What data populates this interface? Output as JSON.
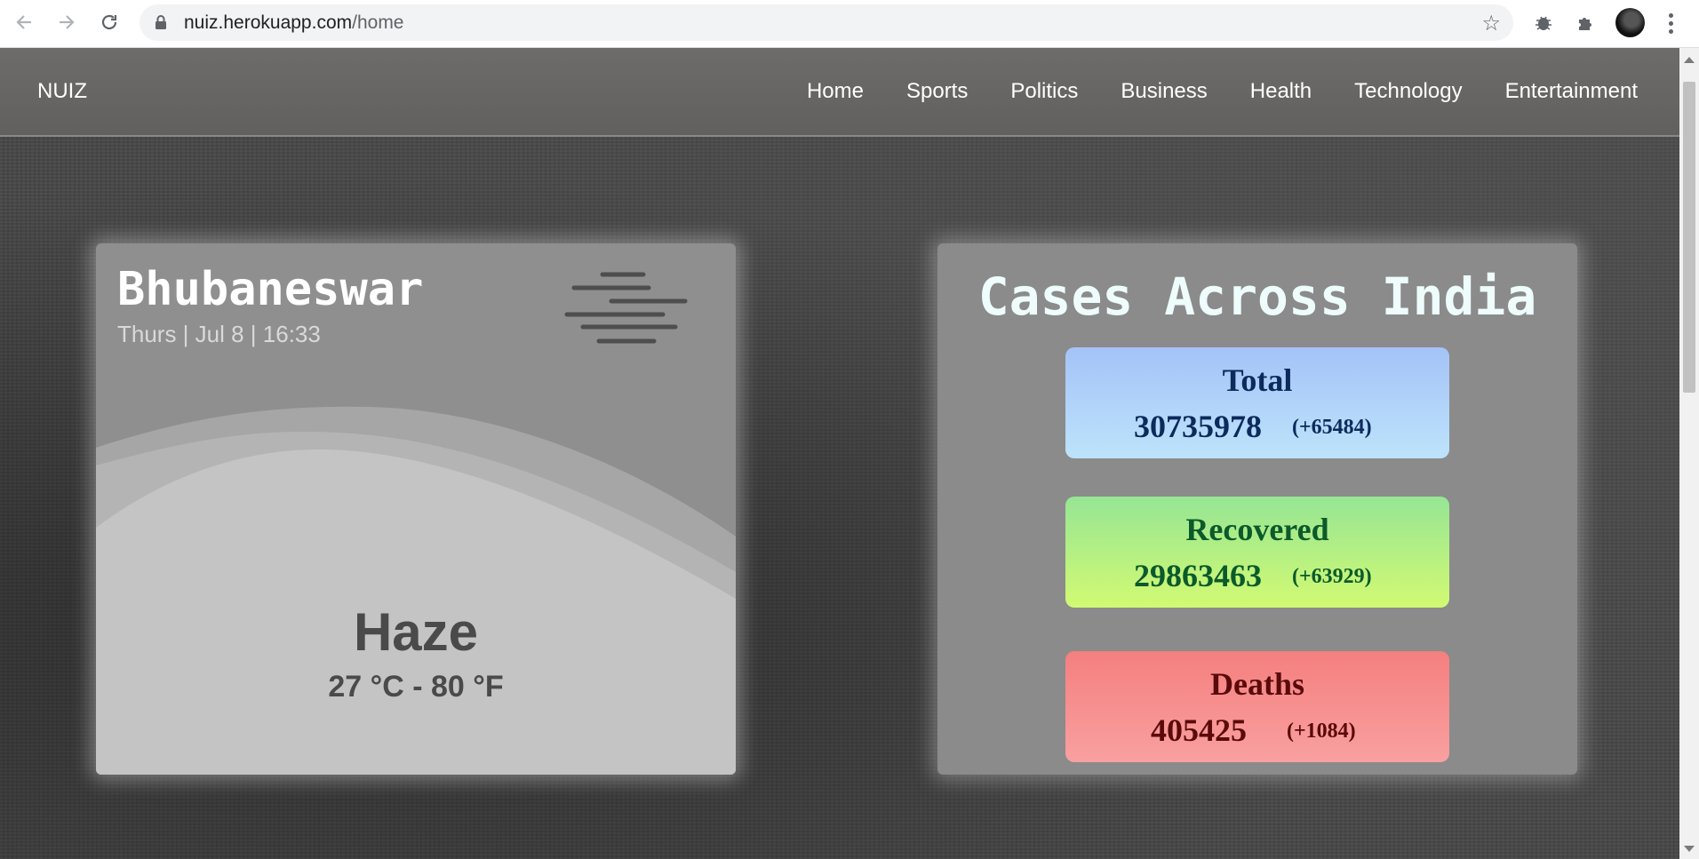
{
  "browser": {
    "url_host": "nuiz.herokuapp.com",
    "url_path": "/home",
    "icons": {
      "back": "arrow-left-icon",
      "forward": "arrow-right-icon",
      "reload": "reload-icon",
      "secure": "lock-icon",
      "bookmark": "star-icon",
      "extension_1": "bug-icon",
      "extensions": "puzzle-icon",
      "profile": "avatar",
      "menu": "kebab-menu-icon"
    }
  },
  "navbar": {
    "brand": "NUIZ",
    "links": [
      "Home",
      "Sports",
      "Politics",
      "Business",
      "Health",
      "Technology",
      "Entertainment"
    ]
  },
  "weather": {
    "city": "Bhubaneswar",
    "datetime": "Thurs | Jul 8 | 16:33",
    "condition": "Haze",
    "temperature": "27 °C - 80 °F",
    "icon": "haze-icon"
  },
  "covid": {
    "heading": "Cases Across India",
    "total": {
      "label": "Total",
      "count": "30735978",
      "delta": "(+65484)",
      "color": "#0d2a5c"
    },
    "recovered": {
      "label": "Recovered",
      "count": "29863463",
      "delta": "(+63929)",
      "color": "#0b5a2a"
    },
    "deaths": {
      "label": "Deaths",
      "count": "405425",
      "delta": "(+1084)",
      "color": "#5a0a0a"
    }
  }
}
